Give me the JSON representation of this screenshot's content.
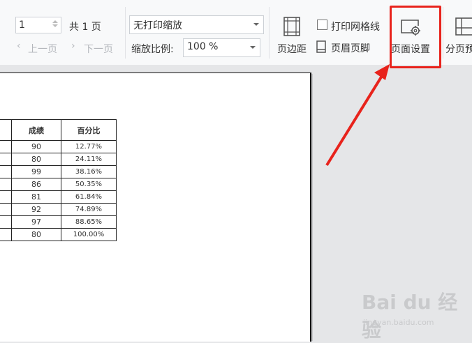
{
  "toolbar": {
    "page_number_value": "1",
    "total_pages_label": "共 1 页",
    "prev_page_label": "上一页",
    "next_page_label": "下一页",
    "print_scaling_value": "无打印缩放",
    "zoom_ratio_label": "缩放比例:",
    "zoom_ratio_value": "100 %",
    "margins_label": "页边距",
    "print_gridlines_label": "打印网格线",
    "header_footer_label": "页眉页脚",
    "page_setup_label": "页面设置",
    "page_break_label": "分页预"
  },
  "sheet": {
    "headers": [
      "",
      "成绩",
      "百分比"
    ],
    "rows": [
      [
        "",
        "90",
        "12.77%"
      ],
      [
        "",
        "80",
        "24.11%"
      ],
      [
        "",
        "99",
        "38.16%"
      ],
      [
        "",
        "86",
        "50.35%"
      ],
      [
        "",
        "81",
        "61.84%"
      ],
      [
        "",
        "92",
        "74.89%"
      ],
      [
        "",
        "97",
        "88.65%"
      ],
      [
        "",
        "80",
        "100.00%"
      ]
    ]
  },
  "annotation": {
    "highlight_color": "#e8231c"
  },
  "watermark": {
    "brand": "Bai du 经验",
    "url": "jingyan.baidu.com"
  }
}
